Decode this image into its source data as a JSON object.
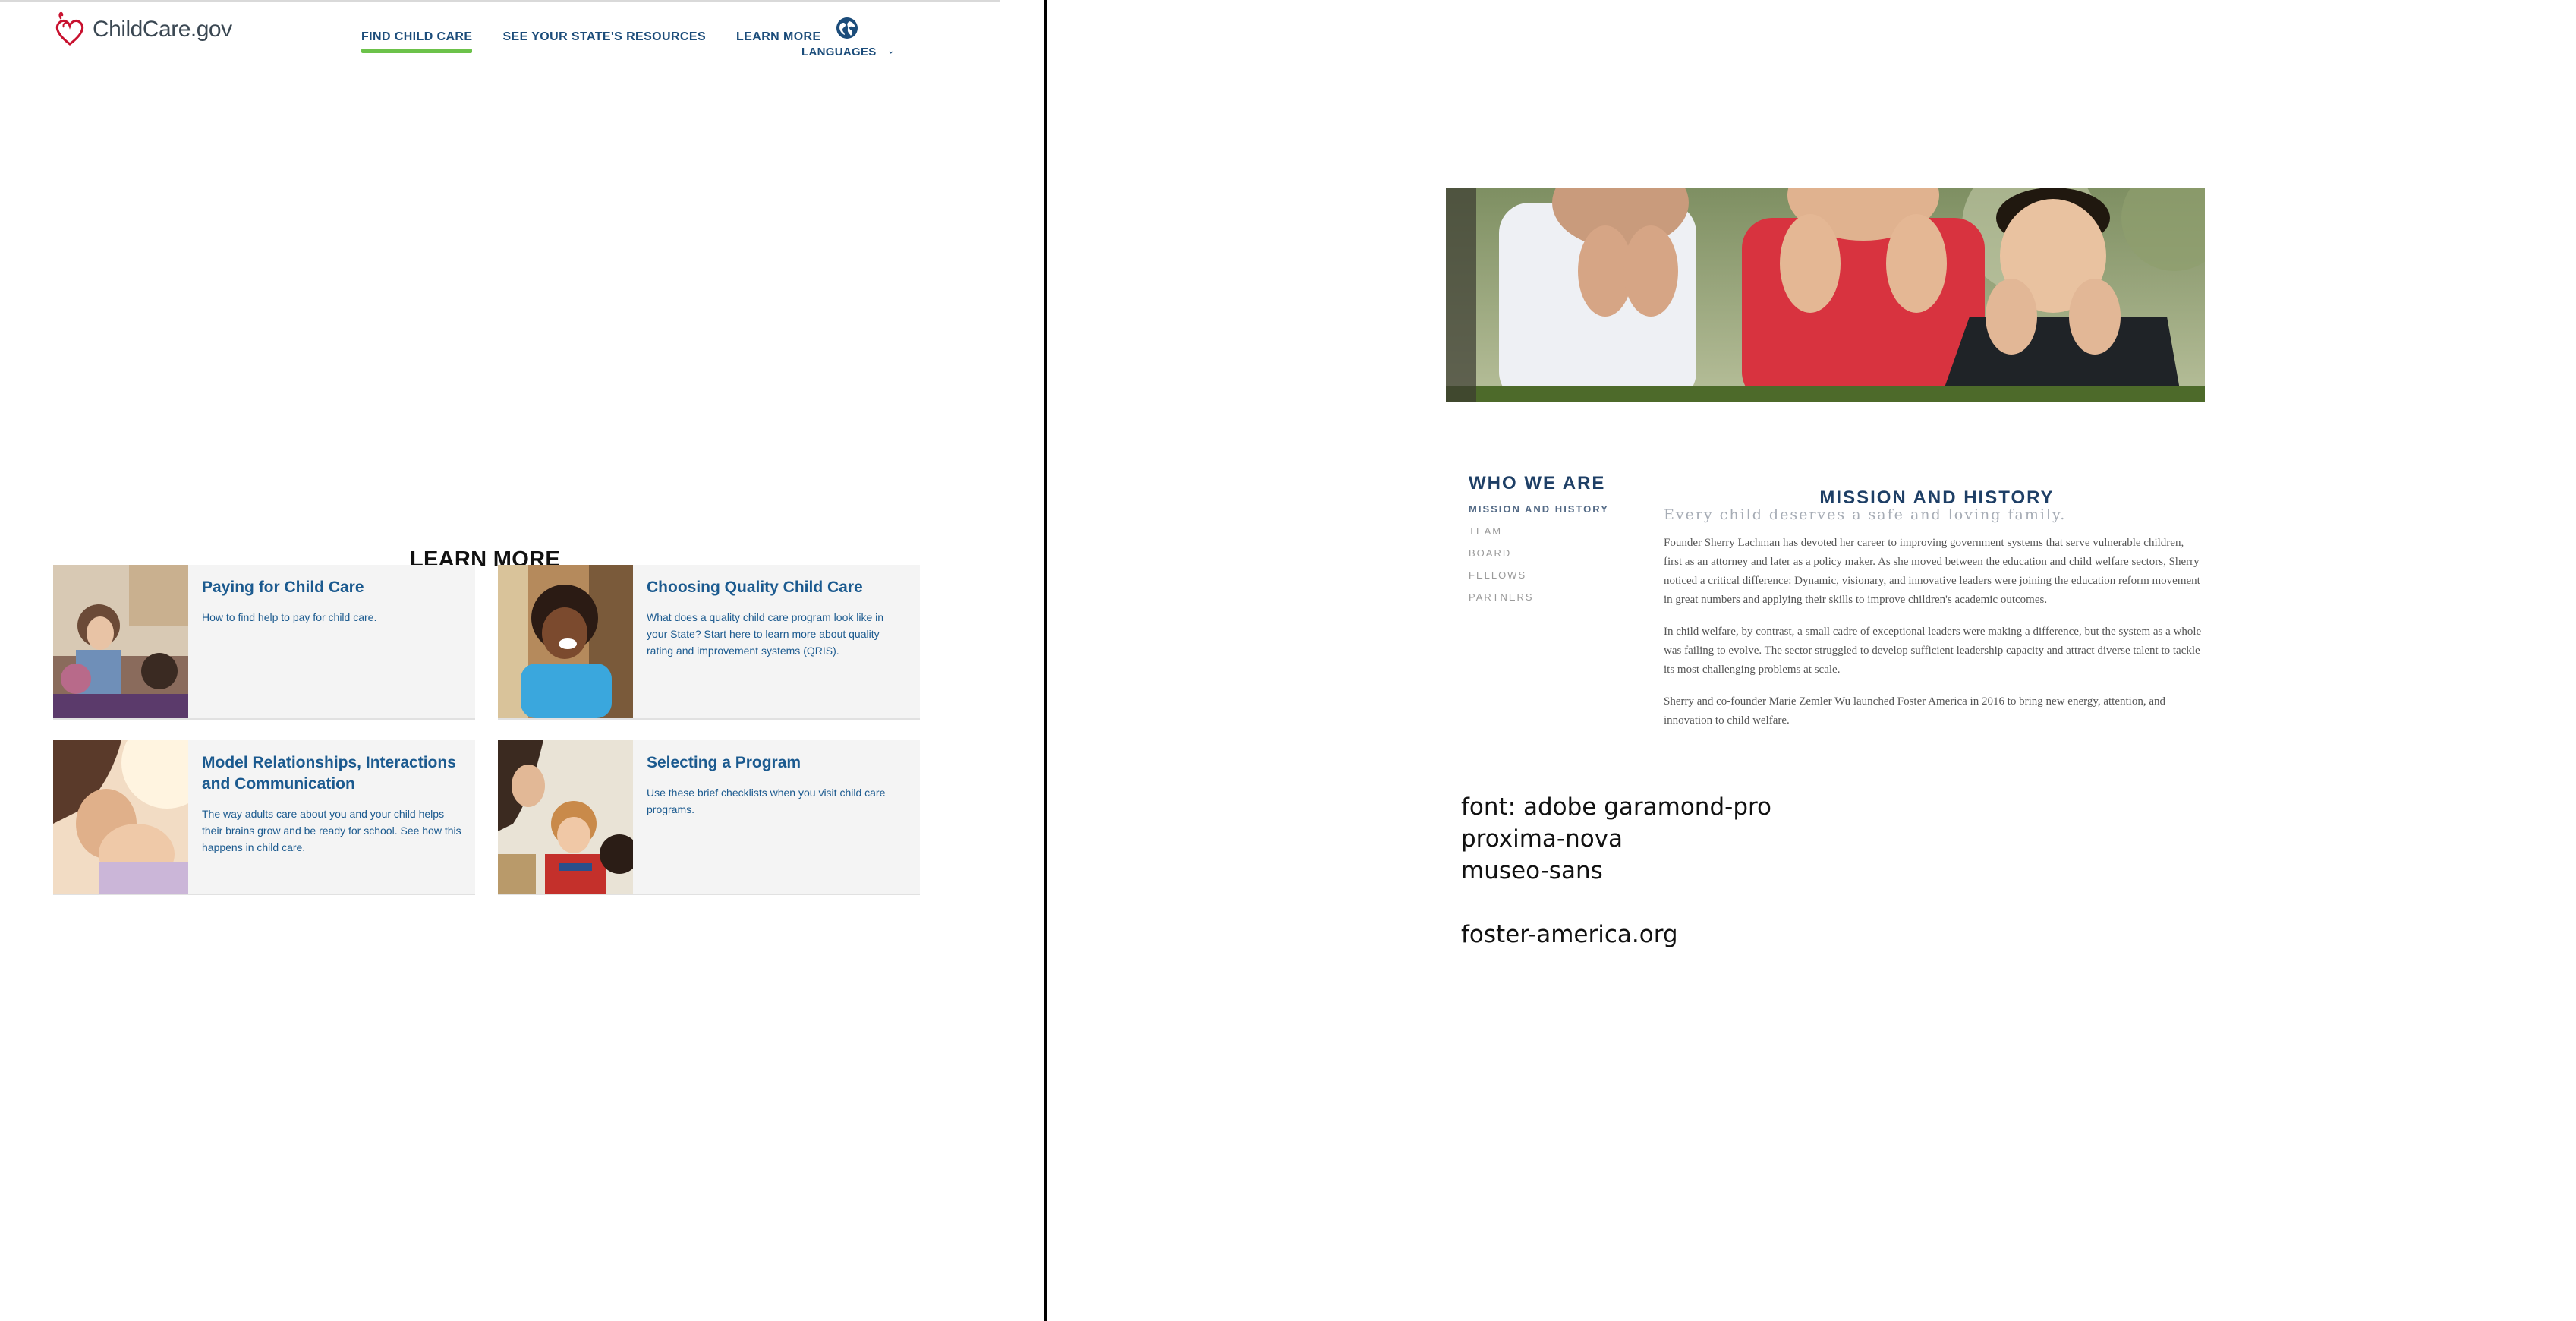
{
  "left": {
    "site": {
      "name": "ChildCare.gov"
    },
    "nav": {
      "items": [
        {
          "label": "FIND CHILD CARE",
          "active": true
        },
        {
          "label": "SEE YOUR STATE'S RESOURCES",
          "active": false
        },
        {
          "label": "LEARN MORE",
          "active": false
        }
      ],
      "languages": {
        "label": "LANGUAGES",
        "icon": "globe-icon",
        "chevron": "chevron-down-icon"
      }
    },
    "section_title": "LEARN MORE",
    "cards": [
      {
        "title": "Paying for Child Care",
        "description": "How to find help to pay for child care."
      },
      {
        "title": "Choosing Quality Child Care",
        "description": "What does a quality child care program look like in your State? Start here to learn more about quality rating and improvement systems (QRIS)."
      },
      {
        "title": "Model Relationships, Interactions and Communication",
        "description": "The way adults care about you and your child helps their brains grow and be ready for school. See how this happens in child care."
      },
      {
        "title": "Selecting a Program",
        "description": "Use these brief checklists when you visit child care programs."
      }
    ],
    "colors": {
      "nav_text": "#1b4c7a",
      "active_underline": "#6cc24a",
      "card_title": "#1b5a8f",
      "card_bg": "#f4f4f4"
    }
  },
  "right": {
    "sub_nav": {
      "title": "WHO WE ARE",
      "items": [
        {
          "label": "MISSION AND HISTORY",
          "active": true
        },
        {
          "label": "TEAM",
          "active": false
        },
        {
          "label": "BOARD",
          "active": false
        },
        {
          "label": "FELLOWS",
          "active": false
        },
        {
          "label": "PARTNERS",
          "active": false
        }
      ]
    },
    "content": {
      "title": "MISSION AND HISTORY",
      "tagline": "Every child deserves a safe and loving family.",
      "paragraphs": [
        "Founder Sherry Lachman has devoted her career to improving government systems that serve vulnerable children, first as an attorney and later as a policy maker. As she moved between the education and child welfare sectors, Sherry noticed a critical difference: Dynamic, visionary, and innovative leaders were joining the education reform movement in great numbers and applying their skills to improve children's academic outcomes.",
        "In child welfare, by contrast, a small cadre of exceptional leaders were making a difference, but the system as a whole was failing to evolve. The sector struggled to develop sufficient leadership capacity and attract diverse talent to tackle its most challenging problems at scale.",
        "Sherry and co-founder Marie Zemler Wu launched Foster America in 2016 to bring new energy, attention, and innovation to child welfare."
      ]
    },
    "notes": {
      "font_line": "font: adobe garamond-pro",
      "font_2": "proxima-nova",
      "font_3": "museo-sans",
      "site": "foster-america.org"
    },
    "colors": {
      "heading": "#1e3f66",
      "tagline": "#a6acb5",
      "body_text": "#555555"
    }
  }
}
